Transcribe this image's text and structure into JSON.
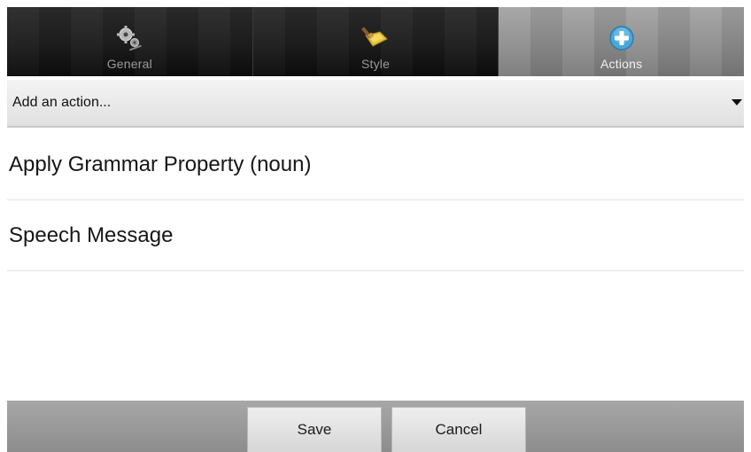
{
  "tabs": [
    {
      "label": "General",
      "icon": "gears-icon",
      "active": false
    },
    {
      "label": "Style",
      "icon": "paint-brush-icon",
      "active": false
    },
    {
      "label": "Actions",
      "icon": "add-circle-icon",
      "active": true
    }
  ],
  "dropdown": {
    "value": "Add an action...",
    "icon": "caret-down-icon"
  },
  "actions": [
    {
      "label": "Apply Grammar Property (noun)"
    },
    {
      "label": "Speech Message"
    }
  ],
  "footer": {
    "save_label": "Save",
    "cancel_label": "Cancel"
  },
  "colors": {
    "tab_bar_dark": "#1a1a1a",
    "tab_active": "#8e8e8e",
    "action_icon_blue": "#4aa6d8",
    "style_icon_yellow": "#e6c23a"
  }
}
